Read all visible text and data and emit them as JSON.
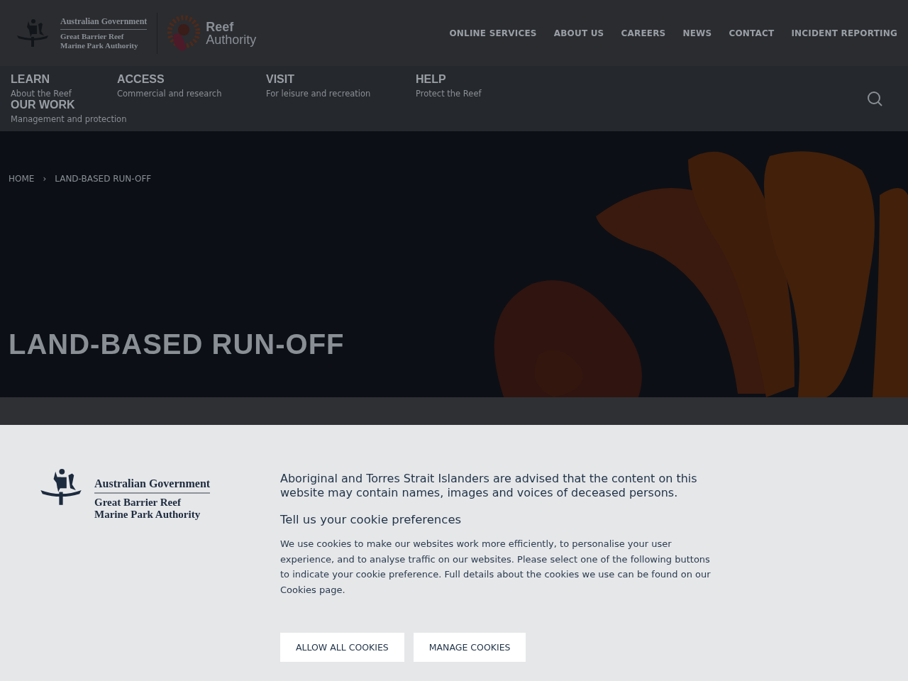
{
  "header": {
    "logo": {
      "government": "Australian Government",
      "agency_line_1": "Great Barrier Reef",
      "agency_line_2": "Marine Park Authority",
      "brand_line_1": "Reef",
      "brand_line_2": "Authority"
    },
    "utility_links": [
      "ONLINE SERVICES",
      "ABOUT US",
      "CAREERS",
      "NEWS",
      "CONTACT",
      "INCIDENT REPORTING"
    ]
  },
  "main_nav": [
    {
      "label": "LEARN",
      "subtitle": "About the Reef"
    },
    {
      "label": "ACCESS",
      "subtitle": "Commercial and research"
    },
    {
      "label": "VISIT",
      "subtitle": "For leisure and recreation"
    },
    {
      "label": "HELP",
      "subtitle": "Protect the Reef"
    },
    {
      "label": "OUR WORK",
      "subtitle": "Management and protection"
    }
  ],
  "breadcrumb": [
    {
      "label": "HOME"
    },
    {
      "label": "LAND-BASED RUN-OFF"
    }
  ],
  "breadcrumb_separator": "›",
  "hero": {
    "title": "LAND-BASED RUN-OFF"
  },
  "cookie_banner": {
    "logo": {
      "government": "Australian Government",
      "agency_line_1": "Great Barrier Reef",
      "agency_line_2": "Marine Park Authority"
    },
    "notice": "Aboriginal and Torres Strait Islanders are advised that the content on this website may contain names, images and voices of deceased persons.",
    "heading": "Tell us your cookie preferences",
    "body": "We use cookies to make our websites work more efficiently, to personalise your user experience, and to analyse traffic on our websites. Please select one of the following buttons to indicate your cookie preference. Full details about the cookies we use can be found on our Cookies page.",
    "buttons": [
      "ALLOW ALL COOKIES",
      "MANAGE COOKIES"
    ]
  }
}
